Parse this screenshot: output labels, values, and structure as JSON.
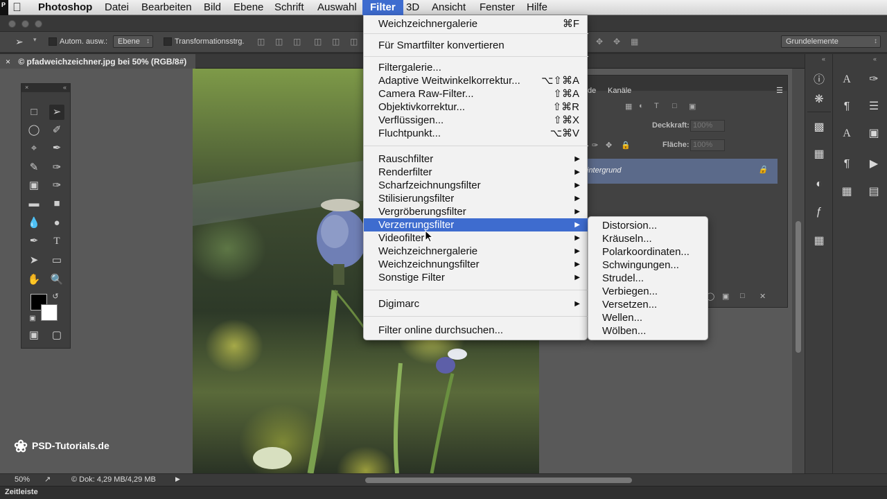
{
  "menubar": {
    "app": "Photoshop",
    "items": [
      "Datei",
      "Bearbeiten",
      "Bild",
      "Ebene",
      "Schrift",
      "Auswahl",
      "Filter",
      "3D",
      "Ansicht",
      "Fenster",
      "Hilfe"
    ],
    "active": "Filter"
  },
  "options": {
    "auto_select_label": "Autom. ausw.:",
    "auto_select_value": "Ebene",
    "transform_label": "Transformationsstrg.",
    "workspace": "Grundelemente"
  },
  "document": {
    "tab_title": "© pfadweichzeichner.jpg bei 50% (RGB/8#)"
  },
  "layers_panel": {
    "tab_partial": "de",
    "tab_channels": "Kanäle",
    "opacity_label": "Deckkraft:",
    "opacity_value": "100%",
    "fill_label": "Fläche:",
    "fill_value": "100%",
    "layer_name": "intergrund"
  },
  "status": {
    "zoom": "50%",
    "doc_info": "© Dok: 4,29 MB/4,29 MB",
    "timeline": "Zeitleiste"
  },
  "watermark": "PSD-Tutorials.de",
  "filter_menu": {
    "last_filter": "Weichzeichnergalerie",
    "last_filter_shortcut": "⌘F",
    "convert_smart": "Für Smartfilter konvertieren",
    "group2": [
      {
        "label": "Filtergalerie...",
        "shortcut": ""
      },
      {
        "label": "Adaptive Weitwinkelkorrektur...",
        "shortcut": "⌥⇧⌘A"
      },
      {
        "label": "Camera Raw-Filter...",
        "shortcut": "⇧⌘A"
      },
      {
        "label": "Objektivkorrektur...",
        "shortcut": "⇧⌘R"
      },
      {
        "label": "Verflüssigen...",
        "shortcut": "⇧⌘X"
      },
      {
        "label": "Fluchtpunkt...",
        "shortcut": "⌥⌘V"
      }
    ],
    "group3": [
      "Rauschfilter",
      "Renderfilter",
      "Scharfzeichnungsfilter",
      "Stilisierungsfilter",
      "Vergröberungsfilter",
      "Verzerrungsfilter",
      "Videofilter",
      "Weichzeichnergalerie",
      "Weichzeichnungsfilter",
      "Sonstige Filter"
    ],
    "highlighted": "Verzerrungsfilter",
    "digimarc": "Digimarc",
    "browse_online": "Filter online durchsuchen..."
  },
  "distort_submenu": [
    "Distorsion...",
    "Kräuseln...",
    "Polarkoordinaten...",
    "Schwingungen...",
    "Strudel...",
    "Verbiegen...",
    "Versetzen...",
    "Wellen...",
    "Wölben..."
  ],
  "colors": {
    "menu_highlight": "#3e6ccf",
    "layer_selected": "#5b6a8a"
  }
}
